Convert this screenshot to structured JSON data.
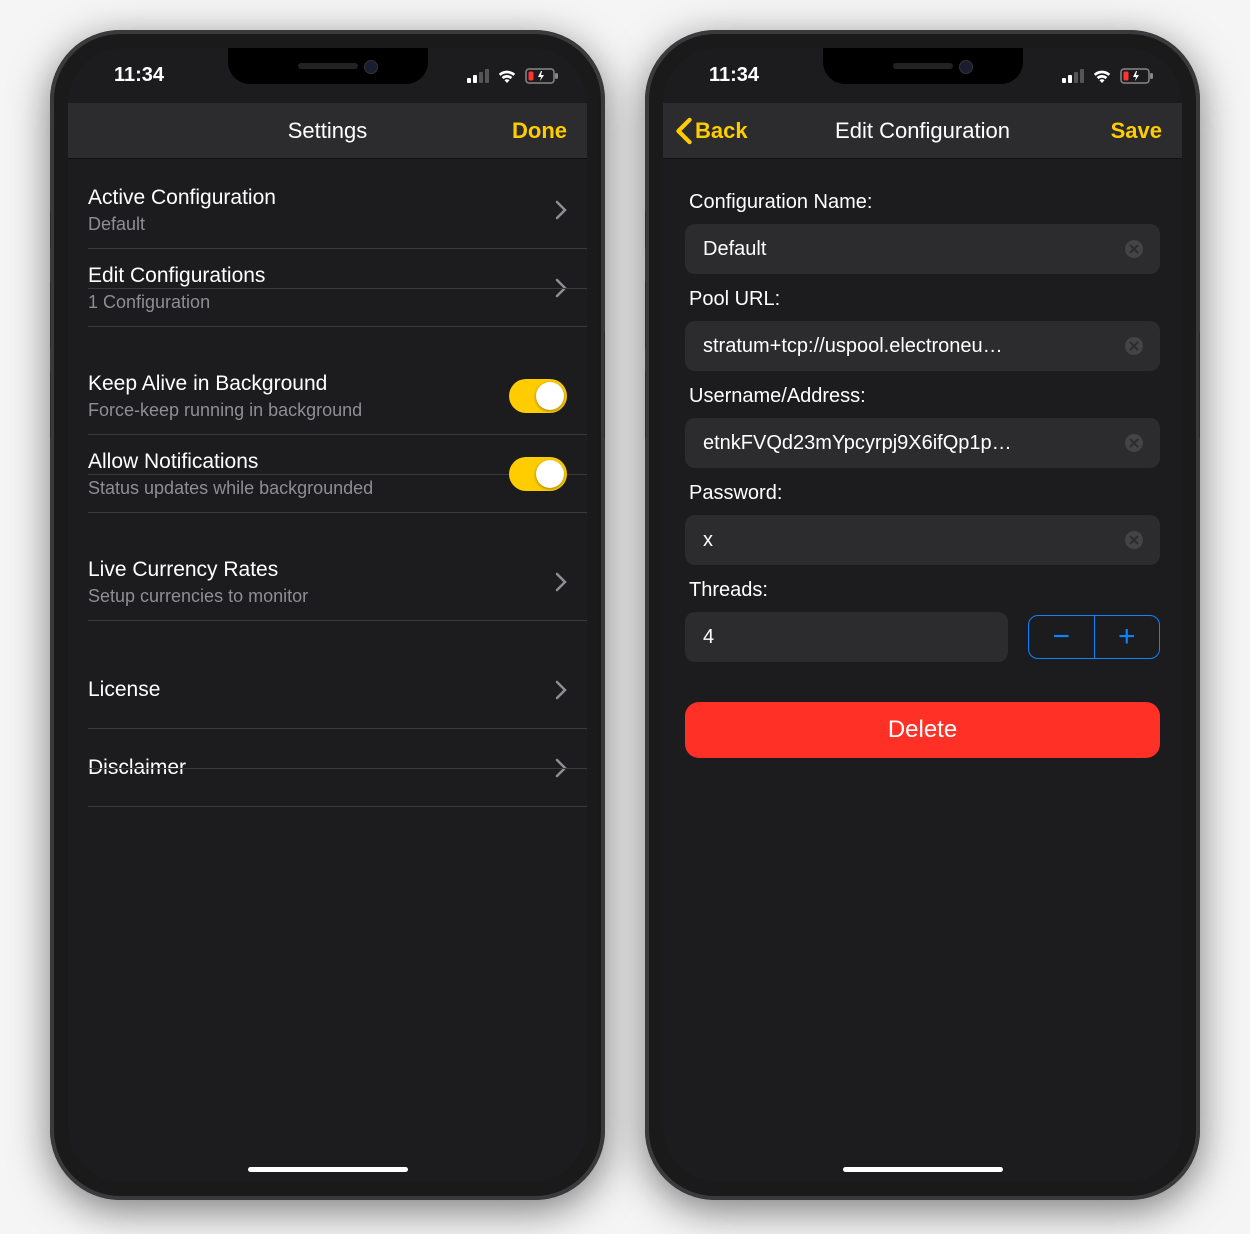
{
  "status": {
    "time": "11:34"
  },
  "accent": "#ffcc00",
  "left": {
    "nav": {
      "title": "Settings",
      "done": "Done"
    },
    "rows": {
      "active": {
        "title": "Active Configuration",
        "sub": "Default"
      },
      "edit": {
        "title": "Edit Configurations",
        "sub": "1 Configuration"
      },
      "keep": {
        "title": "Keep Alive in Background",
        "sub": "Force-keep running in background",
        "on": true
      },
      "notif": {
        "title": "Allow Notifications",
        "sub": "Status updates while backgrounded",
        "on": true
      },
      "rates": {
        "title": "Live Currency Rates",
        "sub": "Setup currencies to monitor"
      },
      "license": {
        "title": "License"
      },
      "disclaimer": {
        "title": "Disclaimer"
      }
    }
  },
  "right": {
    "nav": {
      "back": "Back",
      "title": "Edit Configuration",
      "save": "Save"
    },
    "labels": {
      "name": "Configuration Name:",
      "url": "Pool URL:",
      "user": "Username/Address:",
      "pass": "Password:",
      "threads": "Threads:"
    },
    "values": {
      "name": "Default",
      "url": "stratum+tcp://uspool.electroneu…",
      "user": "etnkFVQd23mYpcyrpj9X6ifQp1p…",
      "pass": "x",
      "threads": "4"
    },
    "delete": "Delete"
  }
}
